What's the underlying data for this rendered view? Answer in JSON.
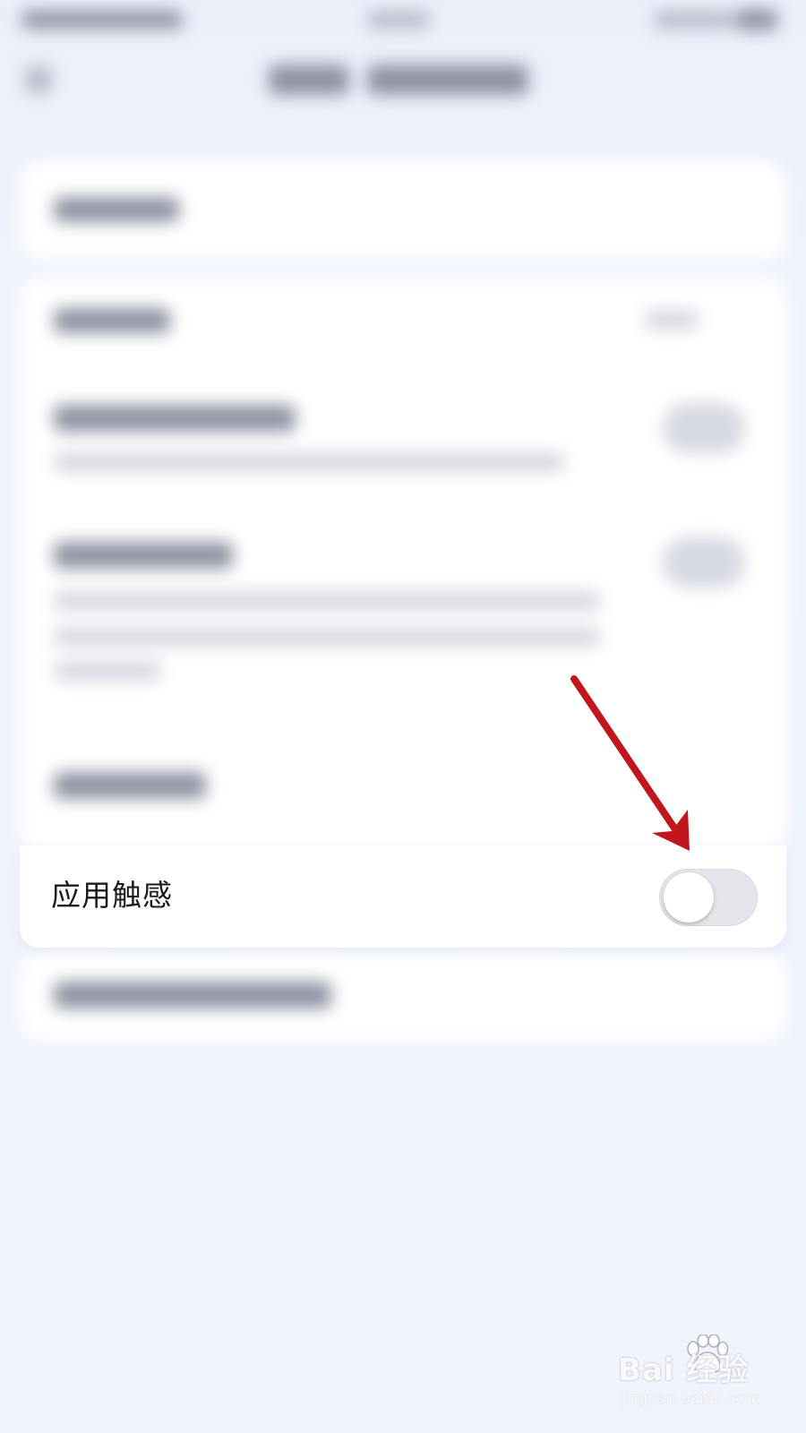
{
  "settings_row": {
    "label": "应用触感",
    "toggle_on": false
  },
  "watermark": {
    "brand": "Bai  经验",
    "url": "jingyan.baidu.com"
  },
  "colors": {
    "annotation_arrow": "#c0161c",
    "toggle_off_track": "#e4e5ea",
    "background": "#f0f3fc"
  }
}
